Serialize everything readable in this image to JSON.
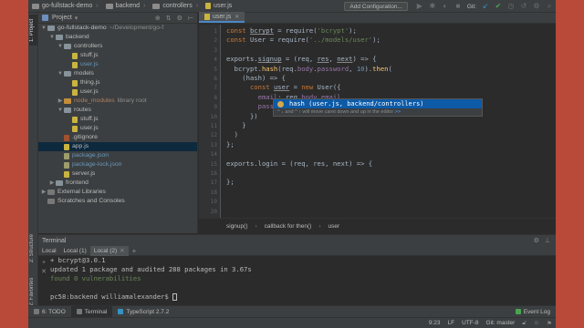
{
  "navbar": {
    "crumbs": [
      "go-fullstack-demo",
      "backend",
      "controllers",
      "user.js"
    ],
    "add_config_label": "Add Configuration...",
    "git_label": "Git:"
  },
  "left_strip": {
    "project_tab": "1: Project",
    "structure_tab": "2: Structure",
    "favorites_tab": "2: Favorites"
  },
  "project_panel": {
    "title": "Project",
    "tree": [
      {
        "depth": 0,
        "arrow": "▼",
        "icon": "folder",
        "name": "go-fullstack-demo",
        "hint": "~/Development/go-f",
        "style": ""
      },
      {
        "depth": 1,
        "arrow": "▼",
        "icon": "folder",
        "name": "backend",
        "hint": "",
        "style": ""
      },
      {
        "depth": 2,
        "arrow": "▼",
        "icon": "folder",
        "name": "controllers",
        "hint": "",
        "style": ""
      },
      {
        "depth": 3,
        "arrow": "",
        "icon": "js",
        "name": "stuff.js",
        "hint": "",
        "style": ""
      },
      {
        "depth": 3,
        "arrow": "",
        "icon": "js",
        "name": "user.js",
        "hint": "",
        "style": "blue"
      },
      {
        "depth": 2,
        "arrow": "▼",
        "icon": "folder",
        "name": "models",
        "hint": "",
        "style": ""
      },
      {
        "depth": 3,
        "arrow": "",
        "icon": "js",
        "name": "thing.js",
        "hint": "",
        "style": ""
      },
      {
        "depth": 3,
        "arrow": "",
        "icon": "js",
        "name": "user.js",
        "hint": "",
        "style": ""
      },
      {
        "depth": 2,
        "arrow": "▶",
        "icon": "folderlib",
        "name": "node_modules",
        "hint": "library root",
        "style": "orange"
      },
      {
        "depth": 2,
        "arrow": "▼",
        "icon": "folder",
        "name": "routes",
        "hint": "",
        "style": ""
      },
      {
        "depth": 3,
        "arrow": "",
        "icon": "js",
        "name": "stuff.js",
        "hint": "",
        "style": ""
      },
      {
        "depth": 3,
        "arrow": "",
        "icon": "js",
        "name": "user.js",
        "hint": "",
        "style": ""
      },
      {
        "depth": 2,
        "arrow": "",
        "icon": "git",
        "name": ".gitignore",
        "hint": "",
        "style": ""
      },
      {
        "depth": 2,
        "arrow": "",
        "icon": "js",
        "name": "app.js",
        "hint": "",
        "style": "",
        "selected": true
      },
      {
        "depth": 2,
        "arrow": "",
        "icon": "json",
        "name": "package.json",
        "hint": "",
        "style": "blue"
      },
      {
        "depth": 2,
        "arrow": "",
        "icon": "json",
        "name": "package-lock.json",
        "hint": "",
        "style": "blue"
      },
      {
        "depth": 2,
        "arrow": "",
        "icon": "js",
        "name": "server.js",
        "hint": "",
        "style": ""
      },
      {
        "depth": 1,
        "arrow": "▶",
        "icon": "folder",
        "name": "frontend",
        "hint": "",
        "style": ""
      },
      {
        "depth": 0,
        "arrow": "▶",
        "icon": "lib",
        "name": "External Libraries",
        "hint": "",
        "style": ""
      },
      {
        "depth": 0,
        "arrow": "",
        "icon": "lib",
        "name": "Scratches and Consoles",
        "hint": "",
        "style": ""
      }
    ]
  },
  "editor": {
    "tab_label": "user.js",
    "line_numbers": [
      "1",
      "2",
      "3",
      "4",
      "5",
      "6",
      "7",
      "8",
      "9",
      "10",
      "11",
      "12",
      "13",
      "14",
      "15",
      "16",
      "17",
      "18",
      "19",
      "20"
    ],
    "code_lines": [
      "const <u>bcrypt</u> = require('bcrypt');",
      "const User = require('../models/user');",
      "",
      "exports.<u>signup</u> = (req, <u>res</u>, <u>next</u>) => {",
      "  bcrypt.hash(req.body.password, 10).then(",
      "    (hash) => {",
      "      const <u>user</u> = new User({",
      "        email: req.body.email,",
      "        password: hash",
      "      })",
      "    }",
      "  )",
      "};",
      "",
      "exports.login = (req, res, next) => {",
      "",
      "};",
      "",
      "",
      ""
    ],
    "autocomplete": {
      "item": "hash (user.js, backend/controllers)",
      "hint": "^ ↓ and ^ ↑ will move caret down and up in the editor",
      "hint_link": ">>"
    },
    "breadcrumb": [
      "signup()",
      "callback for then()",
      "user"
    ]
  },
  "terminal": {
    "title": "Terminal",
    "tabs": [
      "Local",
      "Local (1)",
      "Local (2)"
    ],
    "active_tab": 2,
    "lines": [
      {
        "text": "+ bcrypt@3.0.1",
        "style": ""
      },
      {
        "text": "updated 1 package and audited 288 packages in 3.67s",
        "style": ""
      },
      {
        "text": "found 0 vulnerabilities",
        "style": "green"
      },
      {
        "text": "",
        "style": ""
      },
      {
        "text": "pc58:backend williamalexander$ ",
        "style": "prompt"
      }
    ]
  },
  "bottom_tabs": {
    "todo": "6: TODO",
    "terminal": "Terminal",
    "typescript": "TypeScript 2.7.2",
    "event_log": "Event Log"
  },
  "status_bar": {
    "position": "9:23",
    "line_sep": "LF",
    "encoding": "UTF-8",
    "git_branch": "Git: master"
  }
}
